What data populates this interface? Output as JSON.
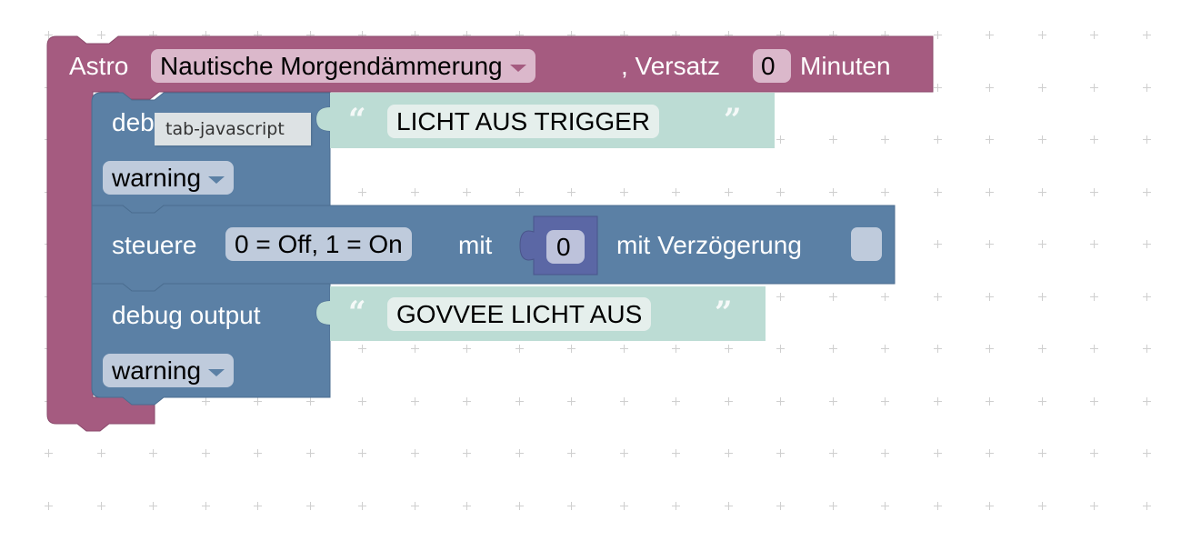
{
  "workspace": {
    "grid_color": "#cfcfcf",
    "background": "#ffffff"
  },
  "colors": {
    "astro_block": "#a55b80",
    "astro_field": "#dbb8cb",
    "statement_block": "#5b80a5",
    "statement_field": "#bfcbdc",
    "text_block": "#bcdcd4",
    "text_field": "#e5efec",
    "number_block": "#5b67a5",
    "number_field": "#bdc2db"
  },
  "astro_block": {
    "label": "Astro",
    "event_dropdown": "Nautische Morgendämmerung",
    "offset_label": ", Versatz",
    "offset_value": "0",
    "unit_label": "Minuten"
  },
  "statements": [
    {
      "type": "debug",
      "label": "debug output",
      "label_visible_fragment": "deb",
      "text_value": "LICHT AUS TRIGGER",
      "level_dropdown": "warning"
    },
    {
      "type": "control",
      "label": "steuere",
      "object_field": "0 = Off, 1 = On",
      "with_label": "mit",
      "value": "0",
      "delay_label": "mit Verzögerung",
      "delay_checked": false
    },
    {
      "type": "debug",
      "label": "debug output",
      "text_value": "GOVVEE LICHT AUS",
      "level_dropdown": "warning"
    }
  ],
  "quote_open": "“",
  "quote_close": "”",
  "tooltip": {
    "text": "tab-javascript"
  }
}
